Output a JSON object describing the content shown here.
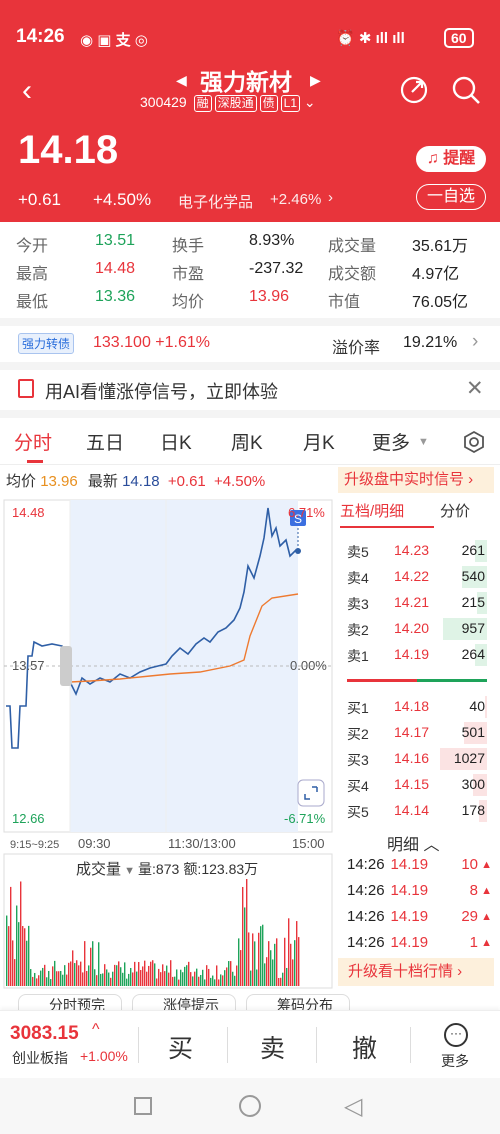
{
  "status": {
    "time": "14:26",
    "battery": "60"
  },
  "header": {
    "name": "强力新材",
    "code": "300429",
    "tags": [
      "融",
      "深股通",
      "债",
      "L1"
    ],
    "price": "14.18",
    "change": "+0.61",
    "change_pct": "+4.50%",
    "sector": "电子化学品",
    "sector_pct": "+2.46%",
    "remind": "提醒",
    "watch": "一自选"
  },
  "stats": [
    {
      "label": "今开",
      "value": "13.51",
      "tone": "grn"
    },
    {
      "label": "换手",
      "value": "8.93%",
      "tone": ""
    },
    {
      "label": "成交量",
      "value": "35.61万",
      "tone": ""
    },
    {
      "label": "最高",
      "value": "14.48",
      "tone": "red"
    },
    {
      "label": "市盈",
      "value": "-237.32",
      "tone": ""
    },
    {
      "label": "成交额",
      "value": "4.97亿",
      "tone": ""
    },
    {
      "label": "最低",
      "value": "13.36",
      "tone": "grn"
    },
    {
      "label": "均价",
      "value": "13.96",
      "tone": "red"
    },
    {
      "label": "市值",
      "value": "76.05亿",
      "tone": ""
    }
  ],
  "bond": {
    "tag": "强力转债",
    "value": "133.100 +1.61%",
    "premium_label": "溢价率",
    "premium": "19.21%"
  },
  "banner": {
    "text": "用AI看懂涨停信号，立即体验"
  },
  "tabs": [
    "分时",
    "五日",
    "日K",
    "周K",
    "月K",
    "更多"
  ],
  "quote_line": {
    "avg_label": "均价",
    "avg": "13.96",
    "last_label": "最新",
    "last": "14.18",
    "chg": "+0.61",
    "pct": "+4.50%",
    "upgrade": "升级盘中实时信号"
  },
  "chart": {
    "ymax": "14.48",
    "ymid": "13.57",
    "ymin": "12.66",
    "pmax": "6.71%",
    "pmid": "0.00%",
    "pmin": "-6.71%",
    "t0": "9:15~9:25",
    "t1": "09:30",
    "t2": "11:30/13:00",
    "t3": "15:00",
    "badge": "S"
  },
  "volume": {
    "label": "成交量",
    "vol": "量:873",
    "amt": "额:123.83万"
  },
  "book": {
    "title_left": "五档/明细",
    "title_right": "分价",
    "asks": [
      {
        "n": "卖5",
        "p": "14.23",
        "v": "261",
        "w": 0.12
      },
      {
        "n": "卖4",
        "p": "14.22",
        "v": "540",
        "w": 0.25
      },
      {
        "n": "卖3",
        "p": "14.21",
        "v": "215",
        "w": 0.1
      },
      {
        "n": "卖2",
        "p": "14.20",
        "v": "957",
        "w": 0.44
      },
      {
        "n": "卖1",
        "p": "14.19",
        "v": "264",
        "w": 0.12
      }
    ],
    "bids": [
      {
        "n": "买1",
        "p": "14.18",
        "v": "40",
        "w": 0.02
      },
      {
        "n": "买2",
        "p": "14.17",
        "v": "501",
        "w": 0.23
      },
      {
        "n": "买3",
        "p": "14.16",
        "v": "1027",
        "w": 0.47
      },
      {
        "n": "买4",
        "p": "14.15",
        "v": "300",
        "w": 0.14
      },
      {
        "n": "买5",
        "p": "14.14",
        "v": "178",
        "w": 0.08
      }
    ],
    "detail_label": "明细",
    "ticks": [
      {
        "t": "14:26",
        "p": "14.19",
        "v": "10"
      },
      {
        "t": "14:26",
        "p": "14.19",
        "v": "8"
      },
      {
        "t": "14:26",
        "p": "14.19",
        "v": "29"
      },
      {
        "t": "14:26",
        "p": "14.19",
        "v": "1"
      }
    ],
    "upgrade": "升级看十档行情"
  },
  "bottom": {
    "index_value": "3083.15",
    "index_name": "创业板指",
    "index_pct": "+1.00%",
    "buy": "买",
    "sell": "卖",
    "cancel": "撤",
    "more": "更多",
    "peek": [
      "分时预完",
      "涨停提示",
      "筹码分布"
    ]
  }
}
